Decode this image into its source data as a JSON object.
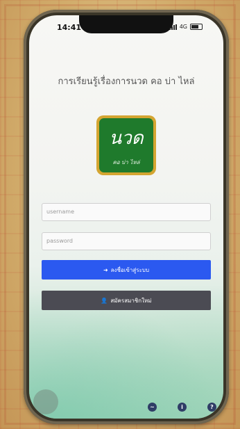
{
  "status_bar": {
    "time": "14:41",
    "network": "4G"
  },
  "header": {
    "title": "การเรียนรู้เรื่องการนวด คอ บ่า ไหล่"
  },
  "logo": {
    "main_text": "นวด",
    "sub_text": "คอ บ่า ไหล่"
  },
  "form": {
    "username_placeholder": "username",
    "password_placeholder": "password",
    "login_button": "ลงชื่อเข้าสู่ระบบ",
    "register_button": "สมัครสมาชิกใหม่"
  },
  "footer": {
    "icons": [
      "messenger-icon",
      "info-icon",
      "help-icon"
    ]
  },
  "colors": {
    "login_button": "#2b59f0",
    "register_button": "#4b4b53",
    "logo_green": "#1f7a2c",
    "logo_gold": "#d4a531"
  }
}
